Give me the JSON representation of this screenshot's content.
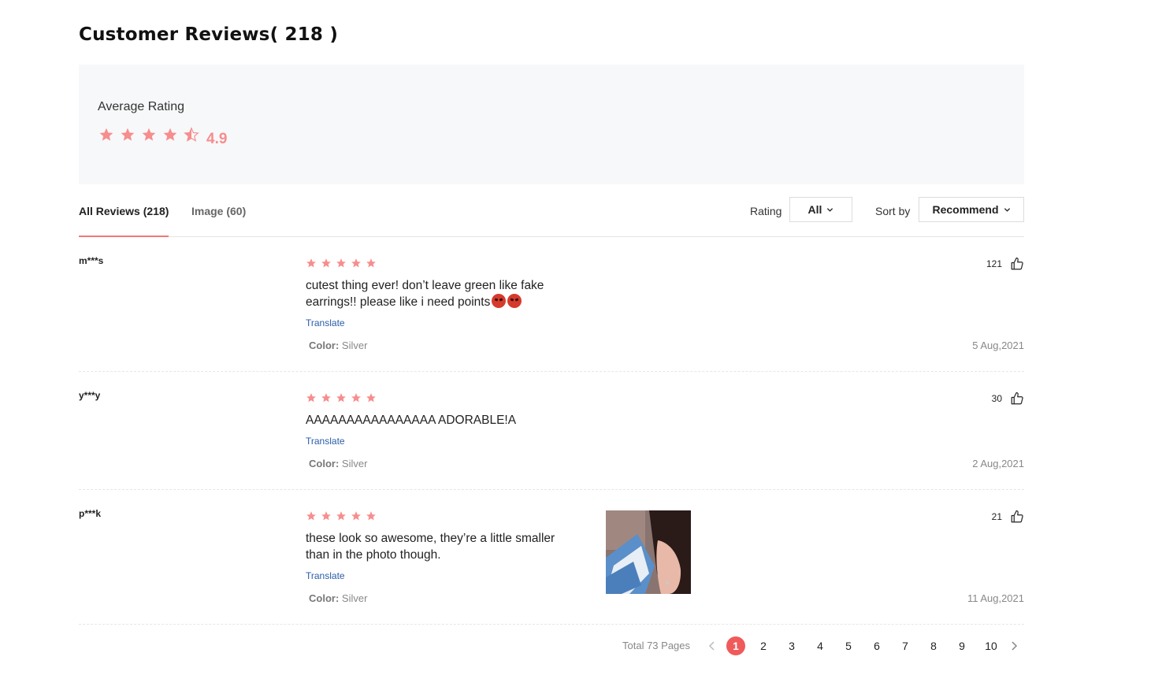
{
  "header": {
    "title": "Customer Reviews( 218 )"
  },
  "summary": {
    "label": "Average Rating",
    "value": "4.9",
    "star_color": "#f78d8d"
  },
  "tabs": [
    {
      "label": "All Reviews (218)",
      "active": true
    },
    {
      "label": "Image (60)",
      "active": false
    }
  ],
  "filters": {
    "rating_label": "Rating",
    "rating_value": "All",
    "sort_label": "Sort by",
    "sort_value": "Recommend"
  },
  "reviews": [
    {
      "user": "m***s",
      "stars": 5,
      "text": "cutest thing ever! don’t leave green like fake earrings!! please like i need points",
      "emoji": "angry-face-icon",
      "translate": "Translate",
      "color_label": "Color:",
      "color_value": "Silver",
      "likes": "121",
      "date": "5 Aug,2021"
    },
    {
      "user": "y***y",
      "stars": 5,
      "text": "AAAAAAAAAAAAAAAA ADORABLE!A",
      "translate": "Translate",
      "color_label": "Color:",
      "color_value": "Silver",
      "likes": "30",
      "date": "2 Aug,2021"
    },
    {
      "user": "p***k",
      "stars": 5,
      "text": "these look so awesome, they’re a little smaller than in the photo though.",
      "translate": "Translate",
      "color_label": "Color:",
      "color_value": "Silver",
      "likes": "21",
      "date": "11 Aug,2021",
      "has_photo": true
    }
  ],
  "pagination": {
    "total": "Total 73 Pages",
    "pages": [
      "1",
      "2",
      "3",
      "4",
      "5",
      "6",
      "7",
      "8",
      "9",
      "10"
    ],
    "current": "1",
    "active_color": "#f05a5a"
  }
}
